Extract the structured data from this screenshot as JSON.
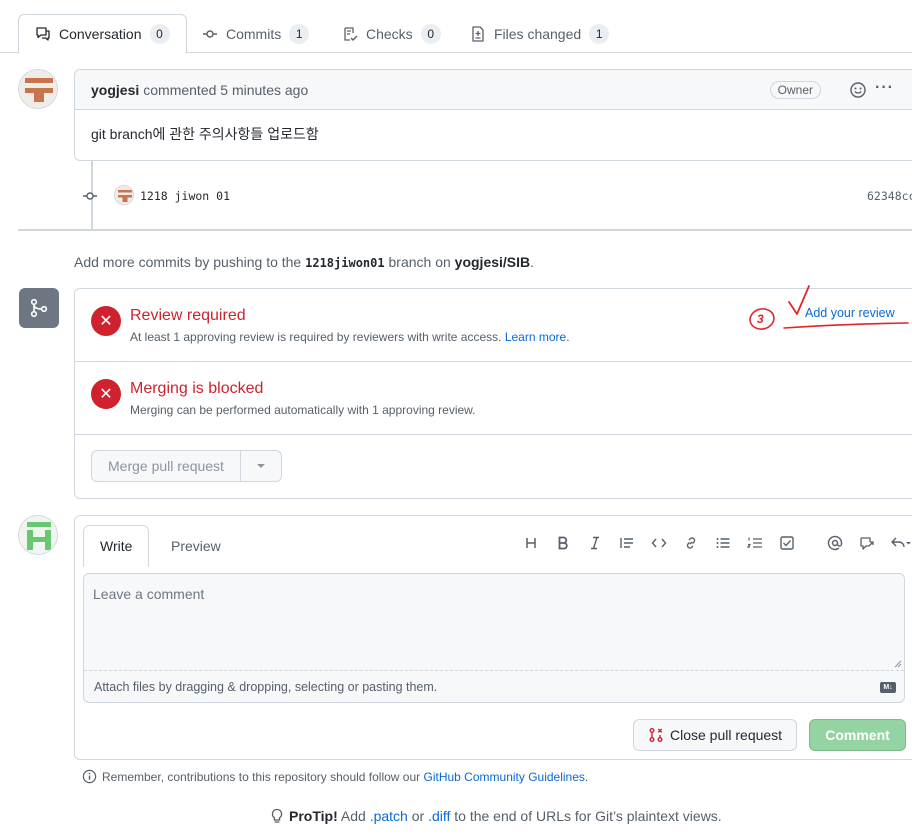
{
  "tabs": [
    {
      "label": "Conversation",
      "count": "0"
    },
    {
      "label": "Commits",
      "count": "1"
    },
    {
      "label": "Checks",
      "count": "0"
    },
    {
      "label": "Files changed",
      "count": "1"
    }
  ],
  "comment": {
    "author": "yogjesi",
    "meta": "commented 5 minutes ago",
    "badge": "Owner",
    "body": "git branch에 관한 주의사항들 업로드함",
    "more_label": "···"
  },
  "commit": {
    "message": "1218 jiwon 01",
    "sha": "62348cc"
  },
  "info": {
    "prefix": "Add more commits by pushing to the",
    "branch": "1218jiwon01",
    "middle": "branch on",
    "repo": "yogjesi/SIB",
    "suffix": "."
  },
  "merge": {
    "review_title": "Review required",
    "review_desc": "At least 1 approving review is required by reviewers with write access.",
    "learn_more": "Learn more.",
    "add_review": "Add your review",
    "annotation_number": "3",
    "blocked_title": "Merging is blocked",
    "blocked_desc": "Merging can be performed automatically with 1 approving review.",
    "merge_button": "Merge pull request"
  },
  "editor": {
    "tab_write": "Write",
    "tab_preview": "Preview",
    "placeholder": "Leave a comment",
    "attach_text": "Attach files by dragging & dropping, selecting or pasting them.",
    "close_button": "Close pull request",
    "comment_button": "Comment",
    "md_label": "M↓"
  },
  "footer": {
    "remember_prefix": "Remember, contributions to this repository should follow our",
    "guidelines_link": "GitHub Community Guidelines",
    "remember_suffix": ".",
    "protip_label": "ProTip!",
    "protip_add": "Add",
    "patch": ".patch",
    "or": "or",
    "diff": ".diff",
    "protip_suffix": "to the end of URLs for Git’s plaintext views."
  },
  "colors": {
    "danger": "#cf222e",
    "link": "#0969da",
    "comment_button": "#94d3a2",
    "annotation": "#e0262b"
  }
}
